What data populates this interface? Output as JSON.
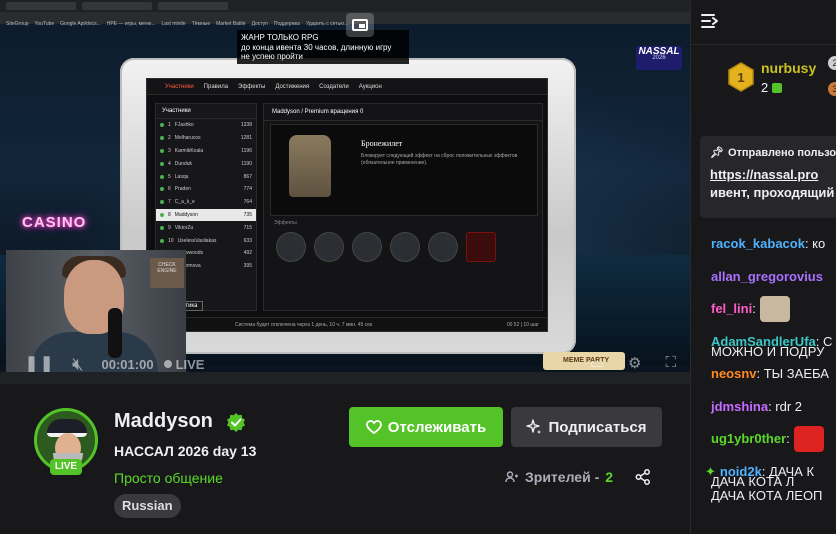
{
  "browser": {
    "bookmarks": [
      "SiteGroup",
      "YouTube",
      "Google Api/docs...",
      "НРЕ — игры, меню...",
      "Last mintle",
      "Тёмные",
      "Market Battle",
      "Доступ",
      "Поддержка",
      "Ударить с сетью..."
    ]
  },
  "video": {
    "announcement_lines": [
      "ЖАНР ТОЛЬКО RPG",
      "до конца ивента  30 часов, длинную игру",
      "не успею пройти"
    ],
    "overlay_brand": "NASSAL",
    "overlay_year": "2026",
    "casino_sign": "CASINO",
    "webcam_sign": "CHECK ENGINE",
    "game": {
      "nav": [
        "Участники",
        "Правила",
        "Эффекты",
        "Достижения",
        "Создатели",
        "Аукцион"
      ],
      "left_header": "Участники",
      "players": [
        {
          "rank": "1",
          "name": "FJashko",
          "score": "1338"
        },
        {
          "rank": "2",
          "name": "Melharucos",
          "score": "1281"
        },
        {
          "rank": "3",
          "name": "KarmikKoala",
          "score": "1196"
        },
        {
          "rank": "4",
          "name": "Dunduk",
          "score": "1190"
        },
        {
          "rank": "5",
          "name": "Lasqa",
          "score": "867"
        },
        {
          "rank": "6",
          "name": "Praden",
          "score": "774"
        },
        {
          "rank": "7",
          "name": "C_a_k_e",
          "score": "764"
        },
        {
          "rank": "8",
          "name": "Maddyson",
          "score": "735"
        },
        {
          "rank": "9",
          "name": "ViktorZu",
          "score": "715"
        },
        {
          "rank": "10",
          "name": "UselessVasilakas",
          "score": "633"
        },
        {
          "rank": "11",
          "name": "Browwoods",
          "score": "492"
        },
        {
          "rank": "12",
          "name": "Unormova",
          "score": "395"
        }
      ],
      "right_header": "Maddyson  /  Premium вращения  0",
      "item_title": "Бронежилет",
      "item_desc": "Блокирует следующий эффект на сброс положительных эффектов (обязательное применение).",
      "items_label": "Эффекты",
      "footer": "Система будет отключена через 1 день, 10 ч. 7 мин. 45 сек",
      "stats_btn": "Статистика",
      "paging": "00 52 | 10 шаг"
    },
    "controls": {
      "time": "00:01:00",
      "live_label": "LIVE",
      "meme_badge": "MEME PARTY"
    }
  },
  "channel": {
    "name": "Maddyson",
    "title": "НАССАЛ 2026 day 13",
    "category": "Просто общение",
    "language": "Russian",
    "live_badge": "LIVE",
    "follow_label": "Отслеживать",
    "subscribe_label": "Подписаться",
    "viewers_label": "Зрителей -",
    "viewers_count": "2"
  },
  "chat": {
    "top_gifter": {
      "name": "nurbusy",
      "count": "2",
      "rank": "1"
    },
    "second_rank": "2",
    "third_rank": "3",
    "pinned": {
      "header": "Отправлено пользователем",
      "link": "https://nassal.pro",
      "text": "ивент, проходящий"
    },
    "messages": [
      {
        "user": "racok_kabacok",
        "color": "#4fb3ff",
        "text": ": ко"
      },
      {
        "user": "allan_gregorovius",
        "color": "#a970ff",
        "text": ""
      },
      {
        "user": "fel_lini",
        "color": "#ff5cc8",
        "text": ":",
        "emote": "#c8b8a0"
      },
      {
        "user": "AdamSandlerUfa",
        "color": "#3ec7c7",
        "text": ": С",
        "extra": "МОЖНО И ПОДРУ"
      },
      {
        "user": "neosnv",
        "color": "#ff8a1f",
        "text": ": ТЫ ЗАЕБА"
      },
      {
        "user": "jdmshina",
        "color": "#c56bff",
        "text": ": rdr 2"
      },
      {
        "user": "ug1ybr0ther",
        "color": "#5bd92a",
        "text": ":",
        "emote": "#d22"
      },
      {
        "user": "noid2k",
        "color": "#4fb3ff",
        "text": ": ДАЧА К",
        "extra": "ДАЧА КОТА Л"
      }
    ],
    "last_line": "ДАЧА КОТА ЛЕОП"
  }
}
